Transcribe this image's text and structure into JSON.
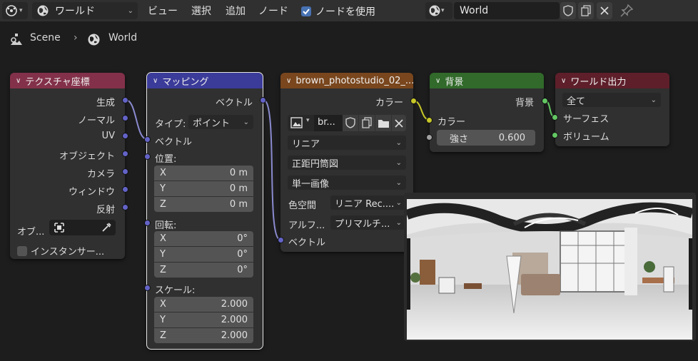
{
  "header": {
    "world_dropdown": "ワールド",
    "menus": [
      "ビュー",
      "選択",
      "追加",
      "ノード"
    ],
    "use_nodes_label": "ノードを使用",
    "world_name": "World"
  },
  "breadcrumb": {
    "scene": "Scene",
    "sep": "›",
    "world": "World"
  },
  "node_texcoord": {
    "title": "テクスチャ座標",
    "outputs": [
      "生成",
      "ノーマル",
      "UV",
      "オブジェクト",
      "カメラ",
      "ウィンドウ",
      "反射"
    ],
    "object_label": "オブ...",
    "instancer_label": "インスタンサー..."
  },
  "node_mapping": {
    "title": "マッピング",
    "output": "ベクトル",
    "type_label": "タイプ:",
    "type_value": "ポイント",
    "input_vector": "ベクトル",
    "location_label": "位置:",
    "location": [
      {
        "axis": "X",
        "value": "0 m"
      },
      {
        "axis": "Y",
        "value": "0 m"
      },
      {
        "axis": "Z",
        "value": "0 m"
      }
    ],
    "rotation_label": "回転:",
    "rotation": [
      {
        "axis": "X",
        "value": "0°"
      },
      {
        "axis": "Y",
        "value": "0°"
      },
      {
        "axis": "Z",
        "value": "0°"
      }
    ],
    "scale_label": "スケール:",
    "scale": [
      {
        "axis": "X",
        "value": "2.000"
      },
      {
        "axis": "Y",
        "value": "2.000"
      },
      {
        "axis": "Z",
        "value": "2.000"
      }
    ]
  },
  "node_envtex": {
    "title": "brown_photostudio_02_...",
    "output_color": "カラー",
    "image_name": "br...",
    "interpolation": "リニア",
    "projection": "正距円筒図",
    "source": "単一画像",
    "colorspace_label": "色空間",
    "colorspace_value": "リニア Rec....",
    "alpha_label": "アルフ...",
    "alpha_value": "プリマルチ...",
    "input_vector": "ベクトル"
  },
  "node_background": {
    "title": "背景",
    "output": "背景",
    "input_color": "カラー",
    "strength_label": "強さ",
    "strength_value": "0.600"
  },
  "node_output": {
    "title": "ワールド出力",
    "target": "全て",
    "input_surface": "サーフェス",
    "input_volume": "ボリューム"
  },
  "colors": {
    "texcoord_header": "#83314a",
    "mapping_header": "#3b3b9a",
    "envtex_header": "#79461d",
    "background_header": "#316a2a",
    "output_header": "#5e1f2a",
    "vector_socket": "#6363c7",
    "color_socket": "#c7c729",
    "shader_socket": "#63c763",
    "float_socket": "#a1a1a1"
  }
}
